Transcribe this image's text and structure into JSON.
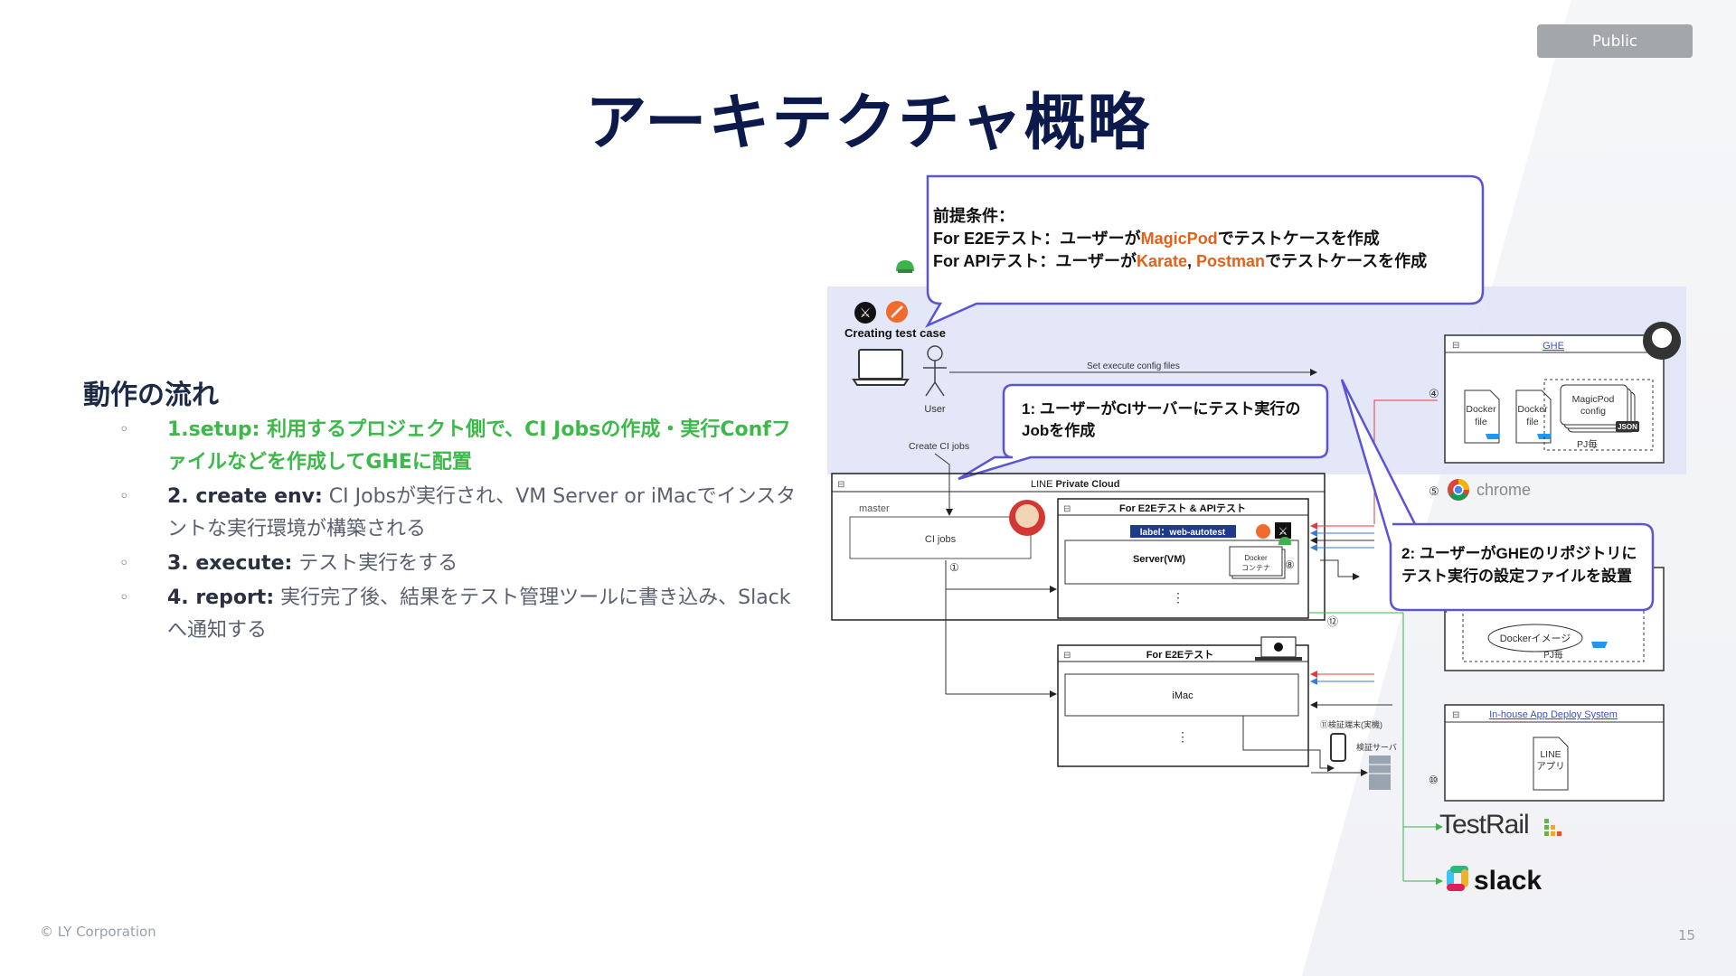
{
  "badge": "Public",
  "title": "アーキテクチャ概略",
  "flow": {
    "heading": "動作の流れ",
    "bullet": "◦",
    "items": [
      {
        "text": "1.setup: 利用するプロジェクト側で、CI Jobsの作成・実行Confファイルなどを作成してGHEに配置"
      },
      {
        "lead": "2.  create env:",
        "text": " CI Jobsが実行され、VM Server or iMacでインスタントな実行環境が構築される"
      },
      {
        "lead": "3. execute:",
        "text": " テスト実行をする"
      },
      {
        "lead": "4. report:",
        "text": " 実行完了後、結果をテスト管理ツールに書き込み、Slackへ通知する"
      }
    ]
  },
  "footer": {
    "copyright": "© LY Corporation",
    "page": "15"
  },
  "diagram": {
    "callout_top": {
      "line1": "前提条件：",
      "line2_a": "For E2Eテスト：ユーザーが",
      "line2_b": "MagicPod",
      "line2_c": "でテストケースを作成",
      "line3_a": "For APIテスト：ユーザーが",
      "line3_b": "Karate",
      "line3_c": ", ",
      "line3_d": "Postman",
      "line3_e": "でテストケースを作成"
    },
    "callout_1": {
      "line1": "1: ユーザーがCIサーバーにテスト実行の",
      "line2": "Jobを作成"
    },
    "callout_2": {
      "line1": "2: ユーザーがGHEのリポジトリに",
      "line2": "テスト実行の設定ファイルを設置"
    },
    "creating": "Creating test case",
    "user": "User",
    "set_config": "Set execute config files",
    "create_jobs": "Create CI jobs",
    "ghe": {
      "title": "GHE",
      "docker1": [
        "Docker",
        "file"
      ],
      "docker2": [
        "Docker",
        "file"
      ],
      "magicpod": [
        "MagicPod",
        "config"
      ],
      "json": "JSON",
      "pj": "PJ毎"
    },
    "chrome": "chrome",
    "private_cloud": {
      "brand": "LINE",
      "text": "Private Cloud"
    },
    "master": "master",
    "ci_jobs": "CI jobs",
    "api_e2e": "For E2Eテスト & APIテスト",
    "label": "label：web-autotest",
    "server": "Server(VM)",
    "docker_container": [
      "Docker",
      "コンテナ"
    ],
    "e2e": "For E2Eテスト",
    "imac": "iMac",
    "device_label": "⑪検証端末(実機)",
    "server_label": "検証サーバ",
    "docker_image": "Dockerイメージ",
    "docker_pj": "PJ毎",
    "deploy": "In-house App Deploy System",
    "line_app": [
      "LINE",
      "アプリ"
    ],
    "testrail": "TestRail",
    "slack": "slack",
    "n1": "①",
    "n4": "④",
    "n5": "⑤",
    "n8": "⑧",
    "n10": "⑩",
    "n12": "⑫",
    "dots": "⋮",
    "minus": "⊟"
  }
}
